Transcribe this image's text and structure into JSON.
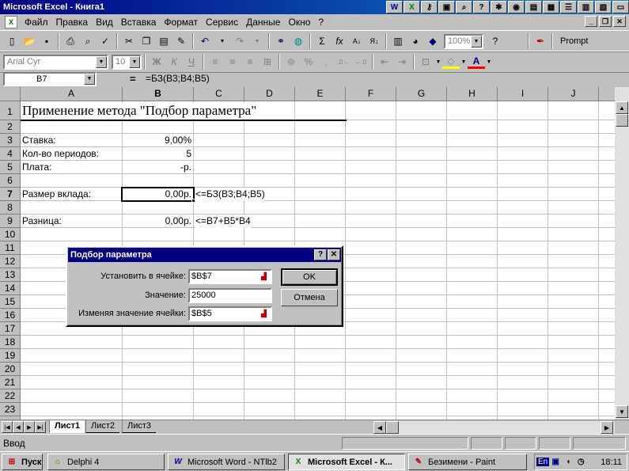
{
  "window": {
    "title": "Microsoft Excel - Книга1"
  },
  "menu": [
    "Файл",
    "Правка",
    "Вид",
    "Вставка",
    "Формат",
    "Сервис",
    "Данные",
    "Окно",
    "?"
  ],
  "toolbar": {
    "zoom": "100%",
    "prompt_label": "Prompt"
  },
  "format_toolbar": {
    "font": "Arial Cyr",
    "size": "10",
    "bold": "Ж",
    "italic": "К",
    "underline": "Ч",
    "percent": "%",
    "comma": ","
  },
  "formula_bar": {
    "name_box": "B7",
    "equals": "=",
    "formula": "=БЗ(B3;B4;B5)"
  },
  "columns": [
    "A",
    "B",
    "C",
    "D",
    "E",
    "F",
    "G",
    "H",
    "I",
    "J"
  ],
  "rows": [
    "1",
    "2",
    "3",
    "4",
    "5",
    "6",
    "7",
    "8",
    "9",
    "10",
    "11",
    "12",
    "13",
    "14",
    "15",
    "16",
    "17",
    "18",
    "19",
    "20",
    "21",
    "22",
    "23"
  ],
  "cells": {
    "a1": "Применение метода \"Подбор параметра\"",
    "a3": "Ставка:",
    "b3": "9,00%",
    "a4": "Кол-во периодов:",
    "b4": "5",
    "a5": "Плата:",
    "b5": "-р.",
    "a7": "Размер вклада:",
    "b7": "0,00р.",
    "c7": "<=БЗ(B3;B4;B5)",
    "a9": "Разница:",
    "b9": "0,00р.",
    "c9": "<=B7+B5*B4"
  },
  "sheets": [
    "Лист1",
    "Лист2",
    "Лист3"
  ],
  "status": {
    "mode": "Ввод"
  },
  "dialog": {
    "title": "Подбор параметра",
    "help": "?",
    "close": "✕",
    "set_cell_label": "Установить в ячейке:",
    "set_cell_value": "$B$7",
    "to_value_label": "Значение:",
    "to_value_value": "25000",
    "changing_label": "Изменяя значение ячейки:",
    "changing_value": "$B$5",
    "ok": "OK",
    "cancel": "Отмена"
  },
  "taskbar": {
    "start": "Пуск",
    "items": [
      "Delphi 4",
      "Microsoft Word - NTlb2",
      "Microsoft Excel - К...",
      "Безимени - Paint"
    ],
    "lang": "En",
    "clock": "18:11"
  },
  "colors": {
    "title_blue": "#000080",
    "face": "#c0c0c0"
  }
}
